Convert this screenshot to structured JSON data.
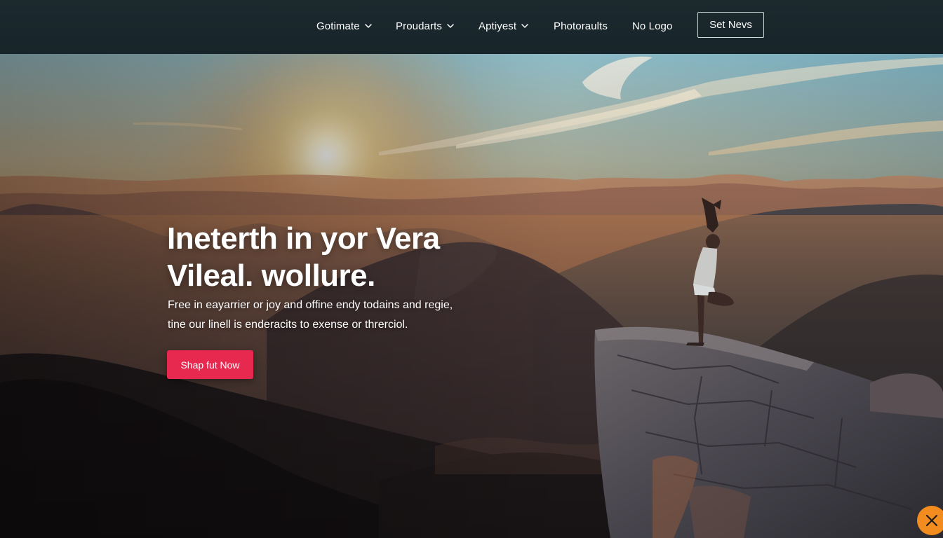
{
  "nav": {
    "items": [
      {
        "label": "Gotimate",
        "has_dropdown": true
      },
      {
        "label": "Proudarts",
        "has_dropdown": true
      },
      {
        "label": "Aptiyest",
        "has_dropdown": true
      },
      {
        "label": "Photoraults",
        "has_dropdown": false
      },
      {
        "label": "No Logo",
        "has_dropdown": false
      }
    ],
    "cta_label": "Set Nevs"
  },
  "hero": {
    "headline_line1": "Ineterth in yor Vera",
    "headline_line2": "Vileal. wollure.",
    "subtext_line1": "Free in eayarrier or joy and offine endy todains and regie,",
    "subtext_line2": "tine our linell is enderacits to exense or threrciol.",
    "cta_label": "Shap fut Now"
  },
  "colors": {
    "nav_bg": "#17252a",
    "cta_accent": "#e8294f",
    "close_widget": "#f28c1e"
  },
  "icons": {
    "dropdown": "chevron-down-icon",
    "close": "close-icon"
  }
}
